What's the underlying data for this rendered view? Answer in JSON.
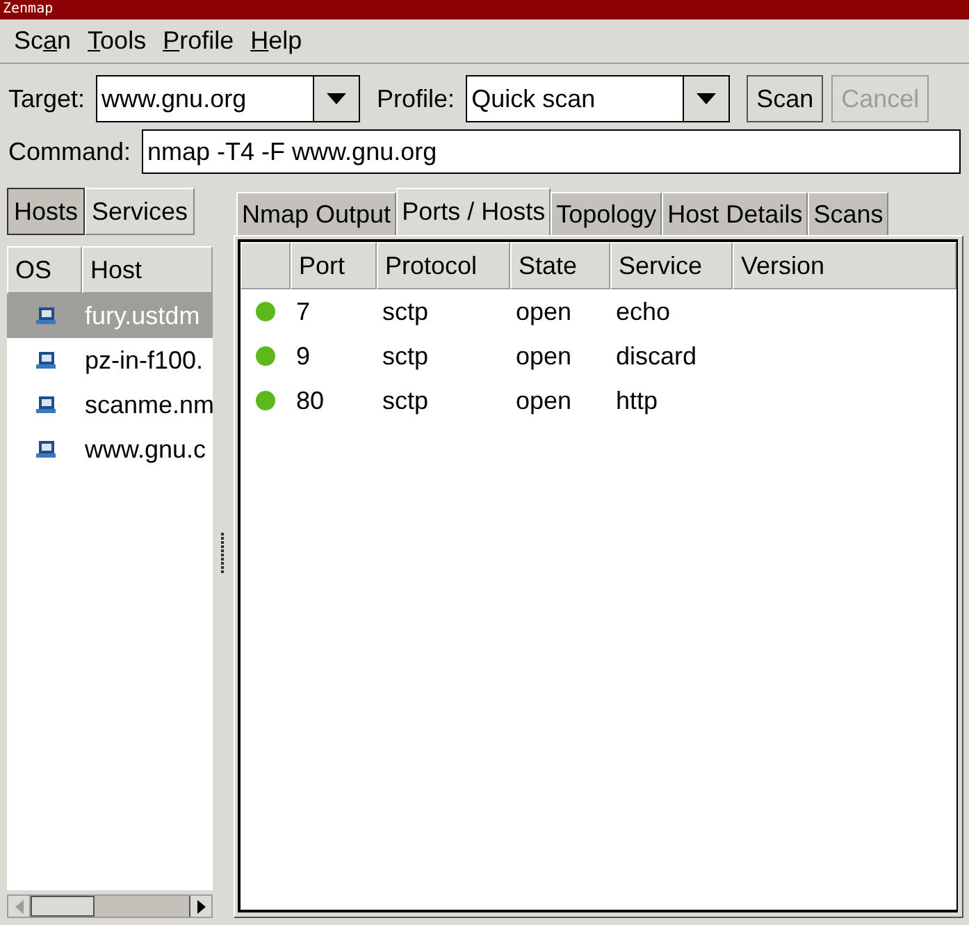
{
  "window": {
    "title": "Zenmap"
  },
  "menu": [
    {
      "pre": "Sc",
      "key": "a",
      "post": "n"
    },
    {
      "key": "T",
      "post": "ools"
    },
    {
      "key": "P",
      "post": "rofile"
    },
    {
      "key": "H",
      "post": "elp"
    }
  ],
  "target": {
    "label": "Target:",
    "value": "www.gnu.org"
  },
  "profile": {
    "label": "Profile:",
    "value": "Quick scan"
  },
  "buttons": [
    {
      "label": "Scan",
      "disabled": false
    },
    {
      "label": "Cancel",
      "disabled": true
    }
  ],
  "command": {
    "label": "Command:",
    "value": "nmap -T4 -F www.gnu.org"
  },
  "view_toggle": [
    {
      "label": "Hosts",
      "selected": true
    },
    {
      "label": "Services",
      "selected": false
    }
  ],
  "hosts": {
    "columns": [
      "OS",
      "Host"
    ],
    "rows": [
      {
        "host": "fury.ustdm",
        "selected": true
      },
      {
        "host": "pz-in-f100.",
        "selected": false
      },
      {
        "host": "scanme.nm",
        "selected": false
      },
      {
        "host": "www.gnu.c",
        "selected": false
      }
    ]
  },
  "tabs": [
    {
      "label": "Nmap Output",
      "selected": false
    },
    {
      "label": "Ports / Hosts",
      "selected": true
    },
    {
      "label": "Topology",
      "selected": false
    },
    {
      "label": "Host Details",
      "selected": false
    },
    {
      "label": "Scans",
      "selected": false
    }
  ],
  "ports": {
    "columns": [
      "Port",
      "Protocol",
      "State",
      "Service",
      "Version"
    ],
    "rows": [
      {
        "port": "7",
        "protocol": "sctp",
        "state": "open",
        "service": "echo",
        "color": "#5cb81c"
      },
      {
        "port": "9",
        "protocol": "sctp",
        "state": "open",
        "service": "discard",
        "color": "#5cb81c"
      },
      {
        "port": "80",
        "protocol": "sctp",
        "state": "open",
        "service": "http",
        "color": "#5cb81c"
      }
    ]
  }
}
